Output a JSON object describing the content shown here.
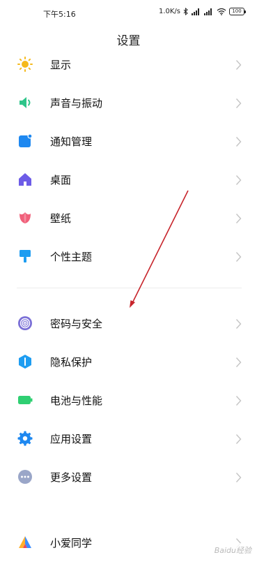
{
  "status_bar": {
    "time": "下午5:16",
    "network_speed": "1.0K/s",
    "battery": "100",
    "icons": [
      "bluetooth-icon",
      "signal-icon",
      "signal-icon",
      "wifi-icon",
      "battery-icon"
    ]
  },
  "header": {
    "title": "设置"
  },
  "settings_items": [
    {
      "label": "显示",
      "icon": "sun-icon",
      "color": "#f5b91b"
    },
    {
      "label": "声音与振动",
      "icon": "speaker-icon",
      "color": "#2ec58a"
    },
    {
      "label": "通知管理",
      "icon": "notification-icon",
      "color": "#1e88f0"
    },
    {
      "label": "桌面",
      "icon": "home-icon",
      "color": "#6d5ce7"
    },
    {
      "label": "壁纸",
      "icon": "tulip-icon",
      "color": "#f0607a"
    },
    {
      "label": "个性主题",
      "icon": "paint-brush-icon",
      "color": "#1e9df1"
    },
    {
      "label": "密码与安全",
      "icon": "fingerprint-icon",
      "color": "#7a6fd6"
    },
    {
      "label": "隐私保护",
      "icon": "privacy-icon",
      "color": "#1e9df1"
    },
    {
      "label": "电池与性能",
      "icon": "battery-icon",
      "color": "#2fcf72"
    },
    {
      "label": "应用设置",
      "icon": "gear-icon",
      "color": "#1e88f0"
    },
    {
      "label": "更多设置",
      "icon": "more-dots-icon",
      "color": "#9aa6c8"
    },
    {
      "label": "小爱同学",
      "icon": "xiaoai-icon",
      "color": "#3c8dff"
    }
  ],
  "watermark": "Baidu经验"
}
